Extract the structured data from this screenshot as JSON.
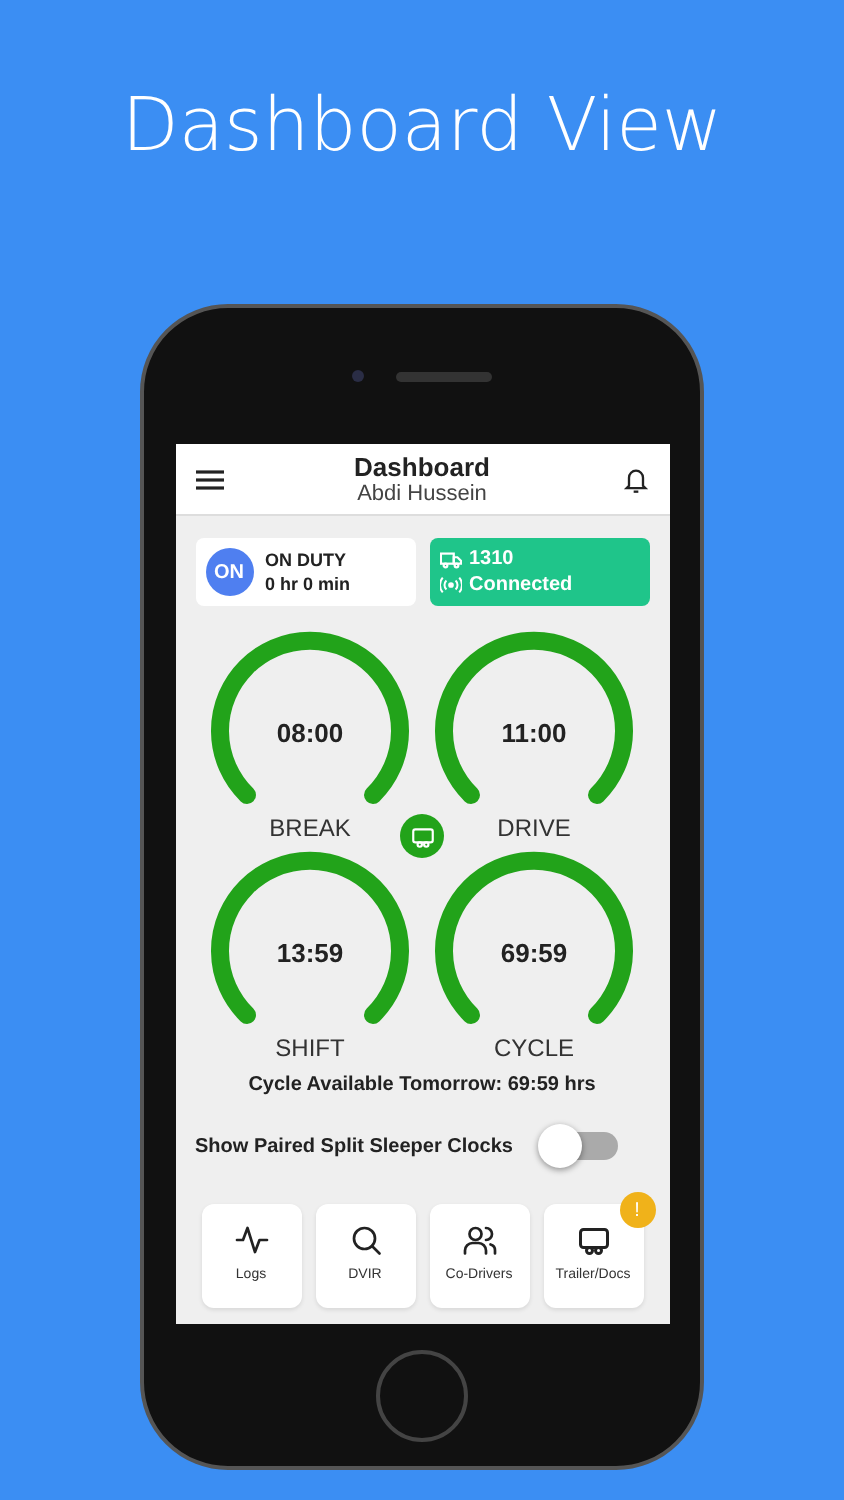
{
  "headline": "Dashboard View",
  "header": {
    "title": "Dashboard",
    "subtitle": "Abdi Hussein"
  },
  "status": {
    "badge": "ON",
    "label": "ON DUTY",
    "duration": "0 hr 0 min"
  },
  "vehicle": {
    "number": "1310",
    "connection": "Connected"
  },
  "clocks": [
    {
      "time": "08:00",
      "label": "BREAK"
    },
    {
      "time": "11:00",
      "label": "DRIVE"
    },
    {
      "time": "13:59",
      "label": "SHIFT"
    },
    {
      "time": "69:59",
      "label": "CYCLE"
    }
  ],
  "cycle_note": "Cycle Available Tomorrow: 69:59 hrs",
  "split_sleeper": {
    "label": "Show Paired Split Sleeper Clocks",
    "on": false
  },
  "tiles": [
    {
      "kind": "logs",
      "label": "Logs"
    },
    {
      "kind": "dvir",
      "label": "DVIR"
    },
    {
      "kind": "codrivers",
      "label": "Co-Drivers"
    },
    {
      "kind": "trailer",
      "label": "Trailer/Docs",
      "badge": "!"
    }
  ]
}
